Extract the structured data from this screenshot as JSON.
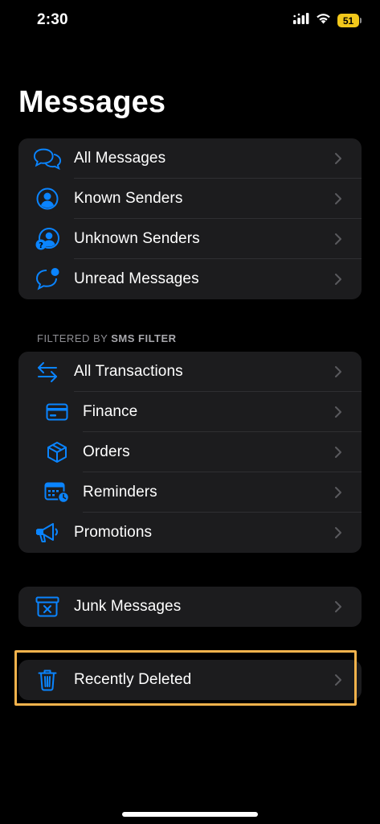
{
  "status_bar": {
    "time": "2:30",
    "battery": "51"
  },
  "title": "Messages",
  "groups": {
    "main": [
      {
        "label": "All Messages",
        "icon": "chat-bubbles-icon"
      },
      {
        "label": "Known Senders",
        "icon": "person-circle-icon"
      },
      {
        "label": "Unknown Senders",
        "icon": "person-question-icon"
      },
      {
        "label": "Unread Messages",
        "icon": "unread-bubble-icon"
      }
    ],
    "filter_header_prefix": "FILTERED BY",
    "filter_header_bold": "SMS FILTER",
    "filtered": [
      {
        "label": "All Transactions",
        "icon": "arrows-exchange-icon"
      },
      {
        "label": "Finance",
        "icon": "credit-card-icon"
      },
      {
        "label": "Orders",
        "icon": "package-icon"
      },
      {
        "label": "Reminders",
        "icon": "calendar-clock-icon"
      },
      {
        "label": "Promotions",
        "icon": "megaphone-icon"
      }
    ],
    "junk": [
      {
        "label": "Junk Messages",
        "icon": "junk-box-icon"
      }
    ],
    "deleted": [
      {
        "label": "Recently Deleted",
        "icon": "trash-icon"
      }
    ]
  },
  "colors": {
    "accent": "#0a84ff",
    "background": "#000000",
    "cell": "#1c1c1e",
    "highlight": "#f4b34c"
  }
}
